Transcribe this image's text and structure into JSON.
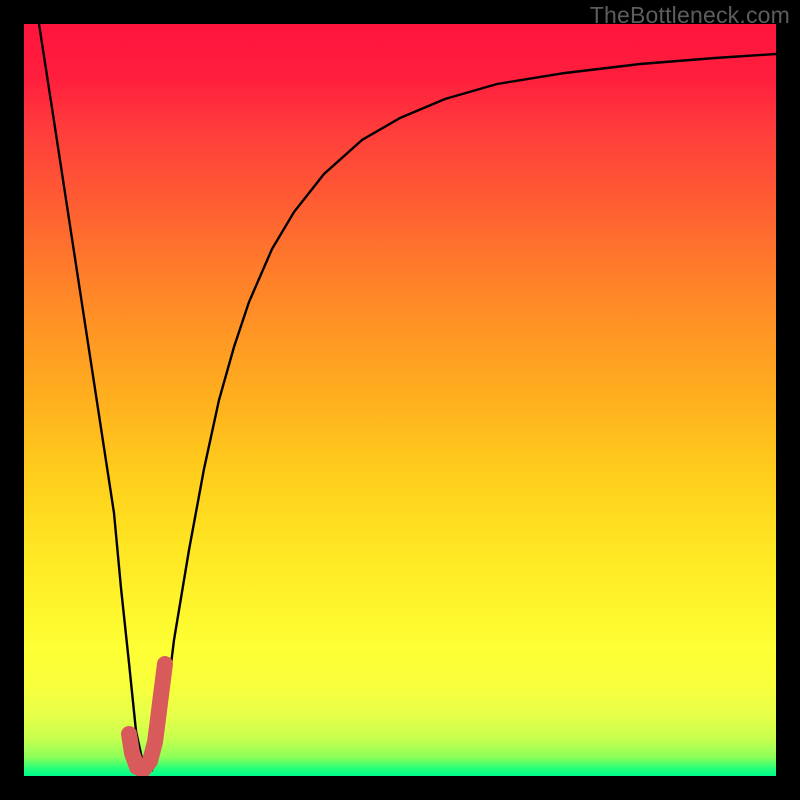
{
  "watermark": "TheBottleneck.com",
  "chart_data": {
    "type": "line",
    "title": "",
    "xlabel": "",
    "ylabel": "",
    "xlim": [
      0,
      100
    ],
    "ylim": [
      0,
      100
    ],
    "series": [
      {
        "name": "bottleneck-curve",
        "x": [
          2,
          4,
          6,
          8,
          10,
          12,
          13,
          14,
          15,
          16,
          17,
          18,
          19,
          20,
          22,
          24,
          26,
          28,
          30,
          33,
          36,
          40,
          45,
          50,
          56,
          63,
          72,
          82,
          92,
          100
        ],
        "values": [
          100,
          87,
          74,
          61,
          48,
          35,
          25,
          15,
          6,
          1,
          1,
          4,
          10,
          18,
          30,
          41,
          50,
          57,
          63,
          70,
          75,
          80,
          84.5,
          87.5,
          90,
          92,
          93.5,
          94.6,
          95.4,
          96
        ]
      },
      {
        "name": "highlight-hook",
        "x": [
          14.0,
          14.4,
          15.0,
          15.8,
          16.8,
          17.4,
          17.8,
          18.2,
          18.7
        ],
        "values": [
          5.5,
          3.0,
          1.2,
          0.8,
          2.0,
          4.5,
          7.5,
          11.0,
          15.0
        ]
      }
    ],
    "gradient_stops": [
      {
        "pos": 0,
        "color": "#ff153d"
      },
      {
        "pos": 50,
        "color": "#ffb01e"
      },
      {
        "pos": 83,
        "color": "#feff34"
      },
      {
        "pos": 100,
        "color": "#00fd8d"
      }
    ]
  }
}
